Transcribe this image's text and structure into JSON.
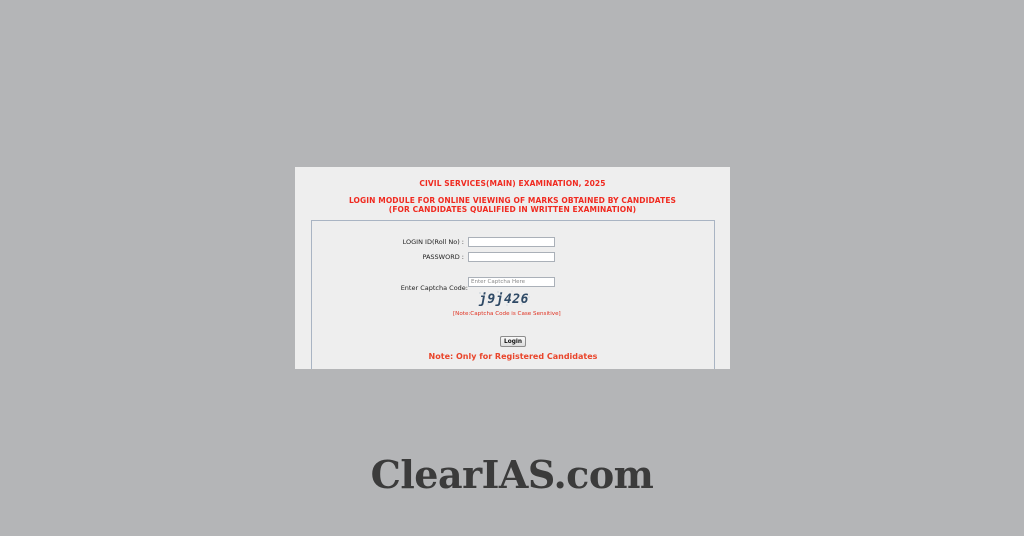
{
  "header": {
    "exam_title": "CIVIL SERVICES(MAIN) EXAMINATION, 2025",
    "module_title": "LOGIN MODULE FOR ONLINE VIEWING OF MARKS OBTAINED BY CANDIDATES",
    "module_subtitle": "(FOR CANDIDATES QUALIFIED IN WRITTEN EXAMINATION)"
  },
  "form": {
    "login_id_label": "LOGIN ID(Roll No) :",
    "login_id_value": "",
    "password_label": "PASSWORD :",
    "password_value": "",
    "captcha_label": "Enter Captcha Code:",
    "captcha_placeholder": "Enter Captcha Here",
    "captcha_text": "j9j426",
    "captcha_note": "[Note:Captcha Code is Case Sensitive]",
    "login_button": "Login",
    "registered_note": "Note: Only for Registered Candidates"
  },
  "brand": {
    "name": "ClearIAS.com"
  },
  "colors": {
    "background": "#b4b5b7",
    "panel": "#eeeeee",
    "heading_red": "#f02a20",
    "note_orange": "#e9452b",
    "brand_text": "#3b3b3b"
  }
}
